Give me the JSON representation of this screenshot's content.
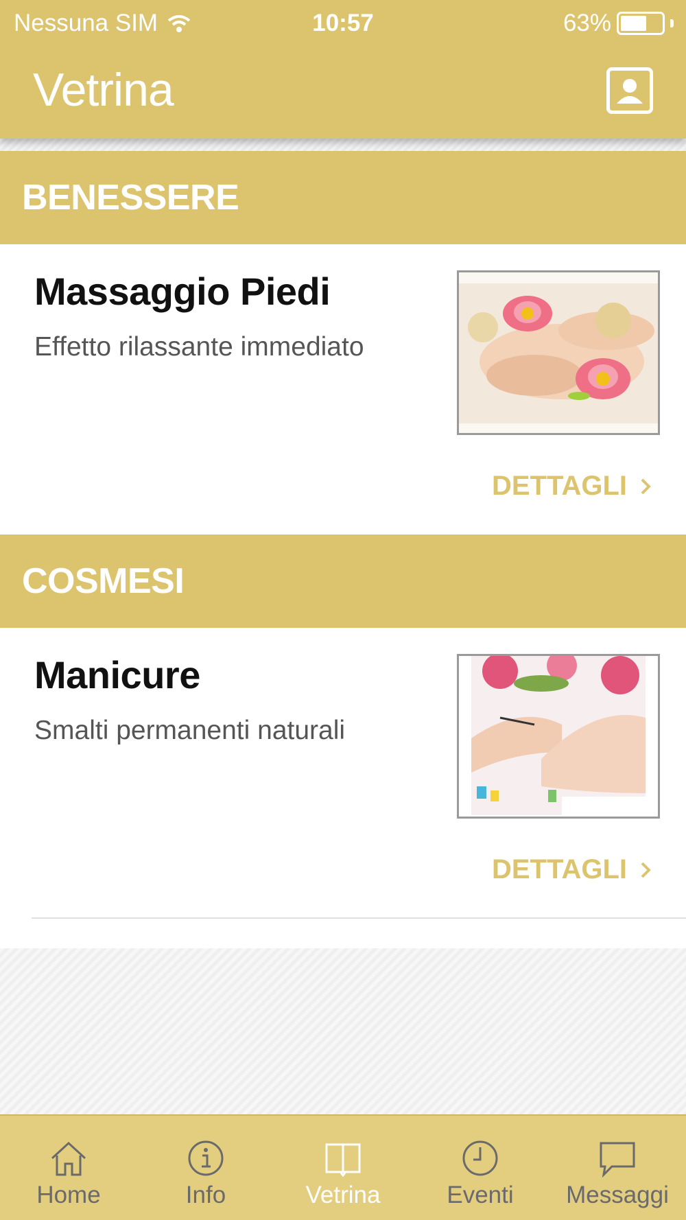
{
  "status_bar": {
    "carrier": "Nessuna SIM",
    "time": "10:57",
    "battery": "63%",
    "battery_level": 0.63
  },
  "nav": {
    "title": "Vetrina",
    "profile_icon": "profile-icon"
  },
  "sections": [
    {
      "header": "BENESSERE",
      "item": {
        "title": "Massaggio Piedi",
        "subtitle": "Effetto rilassante immediato",
        "details_label": "DETTAGLI"
      }
    },
    {
      "header": "COSMESI",
      "item": {
        "title": "Manicure",
        "subtitle": "Smalti permanenti naturali",
        "details_label": "DETTAGLI"
      }
    }
  ],
  "tabs": [
    {
      "label": "Home",
      "icon": "home-icon",
      "active": false
    },
    {
      "label": "Info",
      "icon": "info-icon",
      "active": false
    },
    {
      "label": "Vetrina",
      "icon": "book-icon",
      "active": true
    },
    {
      "label": "Eventi",
      "icon": "clock-icon",
      "active": false
    },
    {
      "label": "Messaggi",
      "icon": "chat-icon",
      "active": false
    }
  ],
  "colors": {
    "accent": "#dcc46e",
    "tabbar": "#e3cd7f",
    "inactive_tab": "#6a6a6a",
    "active_tab": "#ffffff"
  }
}
